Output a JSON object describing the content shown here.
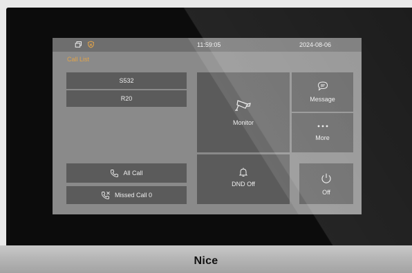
{
  "status_bar": {
    "time": "11:59:05",
    "date": "2024-08-06",
    "icons": [
      "window-icon",
      "shield-icon"
    ]
  },
  "call_list": {
    "title": "Call List",
    "items": [
      {
        "label": "S532"
      },
      {
        "label": "R20"
      }
    ],
    "all_call_label": "All Call",
    "missed_call_label": "Missed Call 0"
  },
  "tiles": {
    "monitor_label": "Monitor",
    "dnd_label": "DND Off",
    "message_label": "Message",
    "more_label": "More",
    "off_label": "Off"
  },
  "brand": {
    "logo_text": "Nice"
  },
  "colors": {
    "accent": "#e2a44a",
    "tile": "#5b5b5b",
    "screen_bg": "#8a8a8a",
    "status_bar": "#6e6e6e"
  }
}
